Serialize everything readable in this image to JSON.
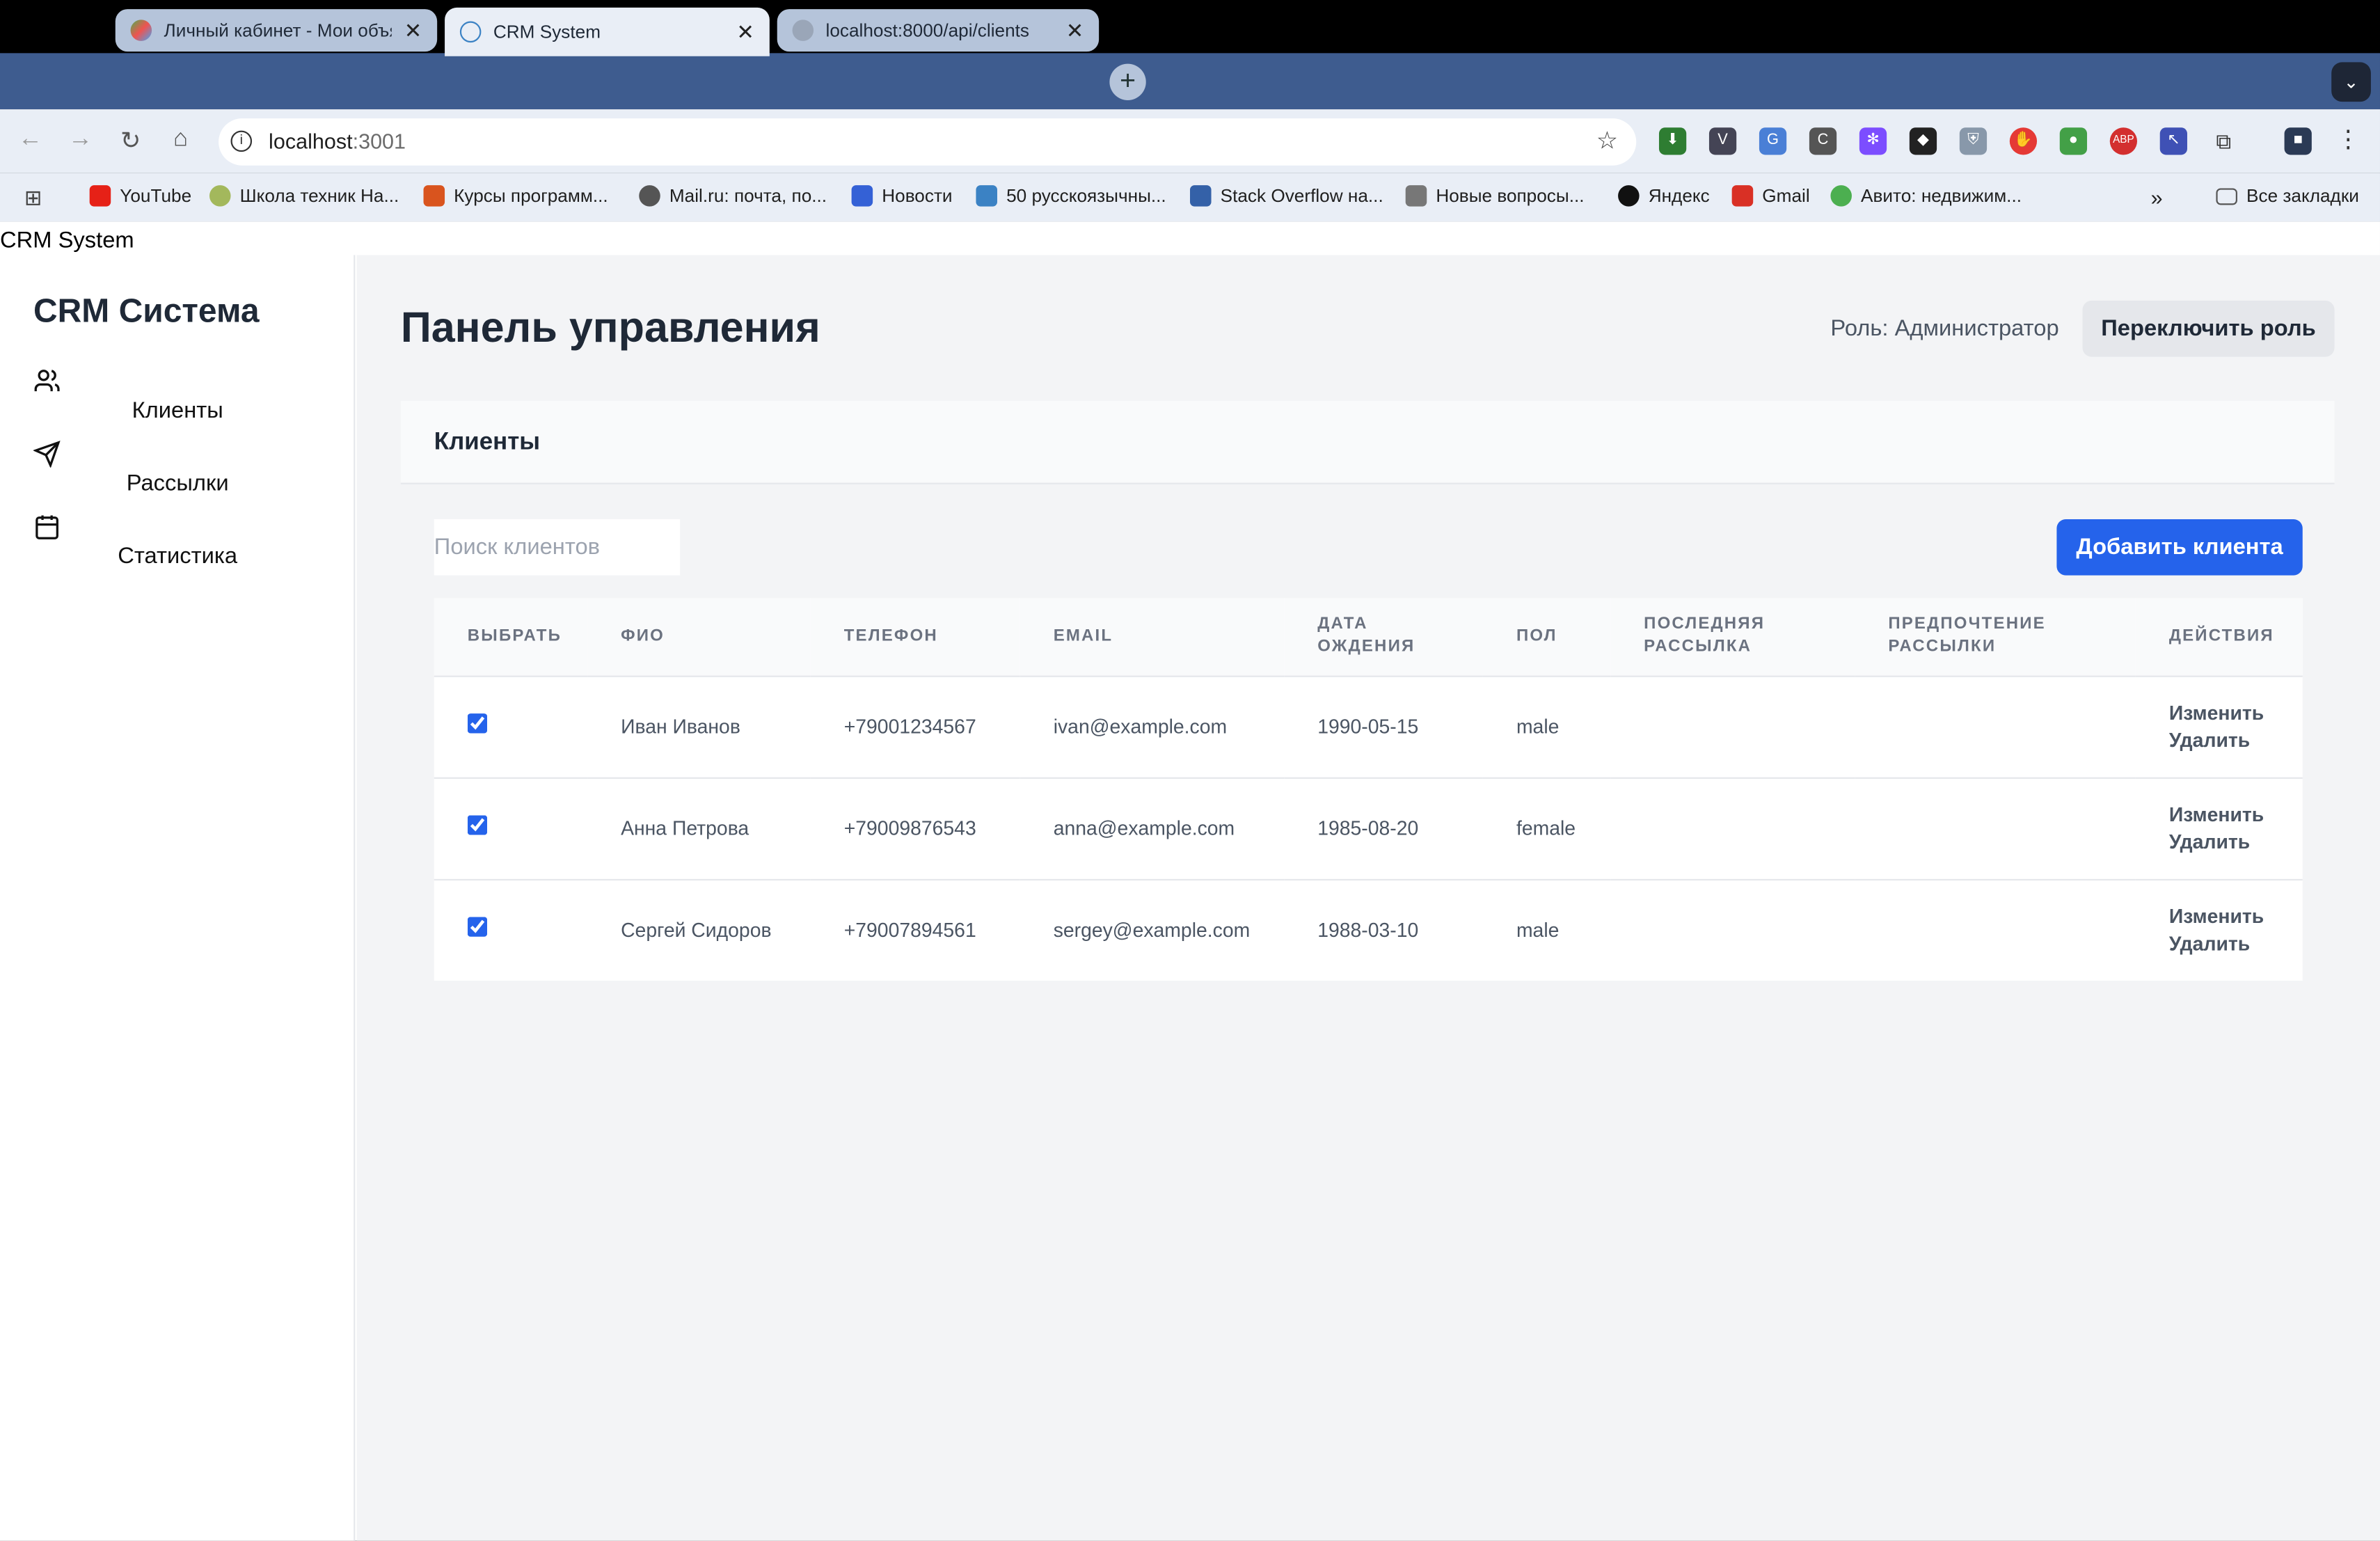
{
  "browser": {
    "tabs": [
      {
        "title": "Личный кабинет - Мои объя",
        "active": false,
        "close": "✕"
      },
      {
        "title": "CRM System",
        "active": true,
        "close": "✕"
      },
      {
        "title": "localhost:8000/api/clients",
        "active": false,
        "close": "✕"
      }
    ],
    "new_tab": "+",
    "url_host": "localhost",
    "url_port": ":3001",
    "bookmarks": [
      {
        "label": "YouTube",
        "color": "#e62117"
      },
      {
        "label": "Школа техник На...",
        "color": "#a3b85c"
      },
      {
        "label": "Курсы программ...",
        "color": "#d9541e"
      },
      {
        "label": "Mail.ru: почта, по...",
        "color": "#555555"
      },
      {
        "label": "Новости",
        "color": "#3461d6"
      },
      {
        "label": "50 русскоязычны...",
        "color": "#3b82c4"
      },
      {
        "label": "Stack Overflow на...",
        "color": "#3461a8"
      },
      {
        "label": "Новые вопросы...",
        "color": "#777777"
      },
      {
        "label": "Яндекс",
        "color": "#111111"
      },
      {
        "label": "Gmail",
        "color": "#d93025"
      },
      {
        "label": "Авито: недвижим...",
        "color": "#4caf50"
      }
    ],
    "all_bookmarks": "Все закладки"
  },
  "document_title": "CRM System",
  "sidebar": {
    "brand": "CRM Система",
    "items": [
      {
        "label": "Клиенты",
        "icon": "users-icon"
      },
      {
        "label": "Рассылки",
        "icon": "send-icon"
      },
      {
        "label": "Статистика",
        "icon": "calendar-icon"
      }
    ]
  },
  "header": {
    "title": "Панель управления",
    "role": "Роль: Администратор",
    "switch_role": "Переключить роль"
  },
  "clients": {
    "card_title": "Клиенты",
    "search_placeholder": "Поиск клиентов",
    "add_button": "Добавить клиента",
    "columns": [
      "ВЫБРАТЬ",
      "ФИО",
      "ТЕЛЕФОН",
      "EMAIL",
      "ДАТА ОЖДЕНИЯ",
      "ПОЛ",
      "ПОСЛЕДНЯЯ РАССЫЛКА",
      "ПРЕДПОЧТЕНИЕ РАССЫЛКИ",
      "ДЕЙСТВИЯ"
    ],
    "rows": [
      {
        "selected": true,
        "name": "Иван Иванов",
        "phone": "+79001234567",
        "email": "ivan@example.com",
        "birth": "1990-05-15",
        "gender": "male",
        "last": "",
        "pref": "",
        "edit": "Изменить",
        "delete": "Удалить"
      },
      {
        "selected": true,
        "name": "Анна Петрова",
        "phone": "+79009876543",
        "email": "anna@example.com",
        "birth": "1985-08-20",
        "gender": "female",
        "last": "",
        "pref": "",
        "edit": "Изменить",
        "delete": "Удалить"
      },
      {
        "selected": true,
        "name": "Сергей Сидоров",
        "phone": "+79007894561",
        "email": "sergey@example.com",
        "birth": "1988-03-10",
        "gender": "male",
        "last": "",
        "pref": "",
        "edit": "Изменить",
        "delete": "Удалить"
      }
    ]
  },
  "colors": {
    "accent": "#2563eb",
    "main_bg": "#f3f4f6",
    "tabstrip": "#3e5c8f"
  }
}
